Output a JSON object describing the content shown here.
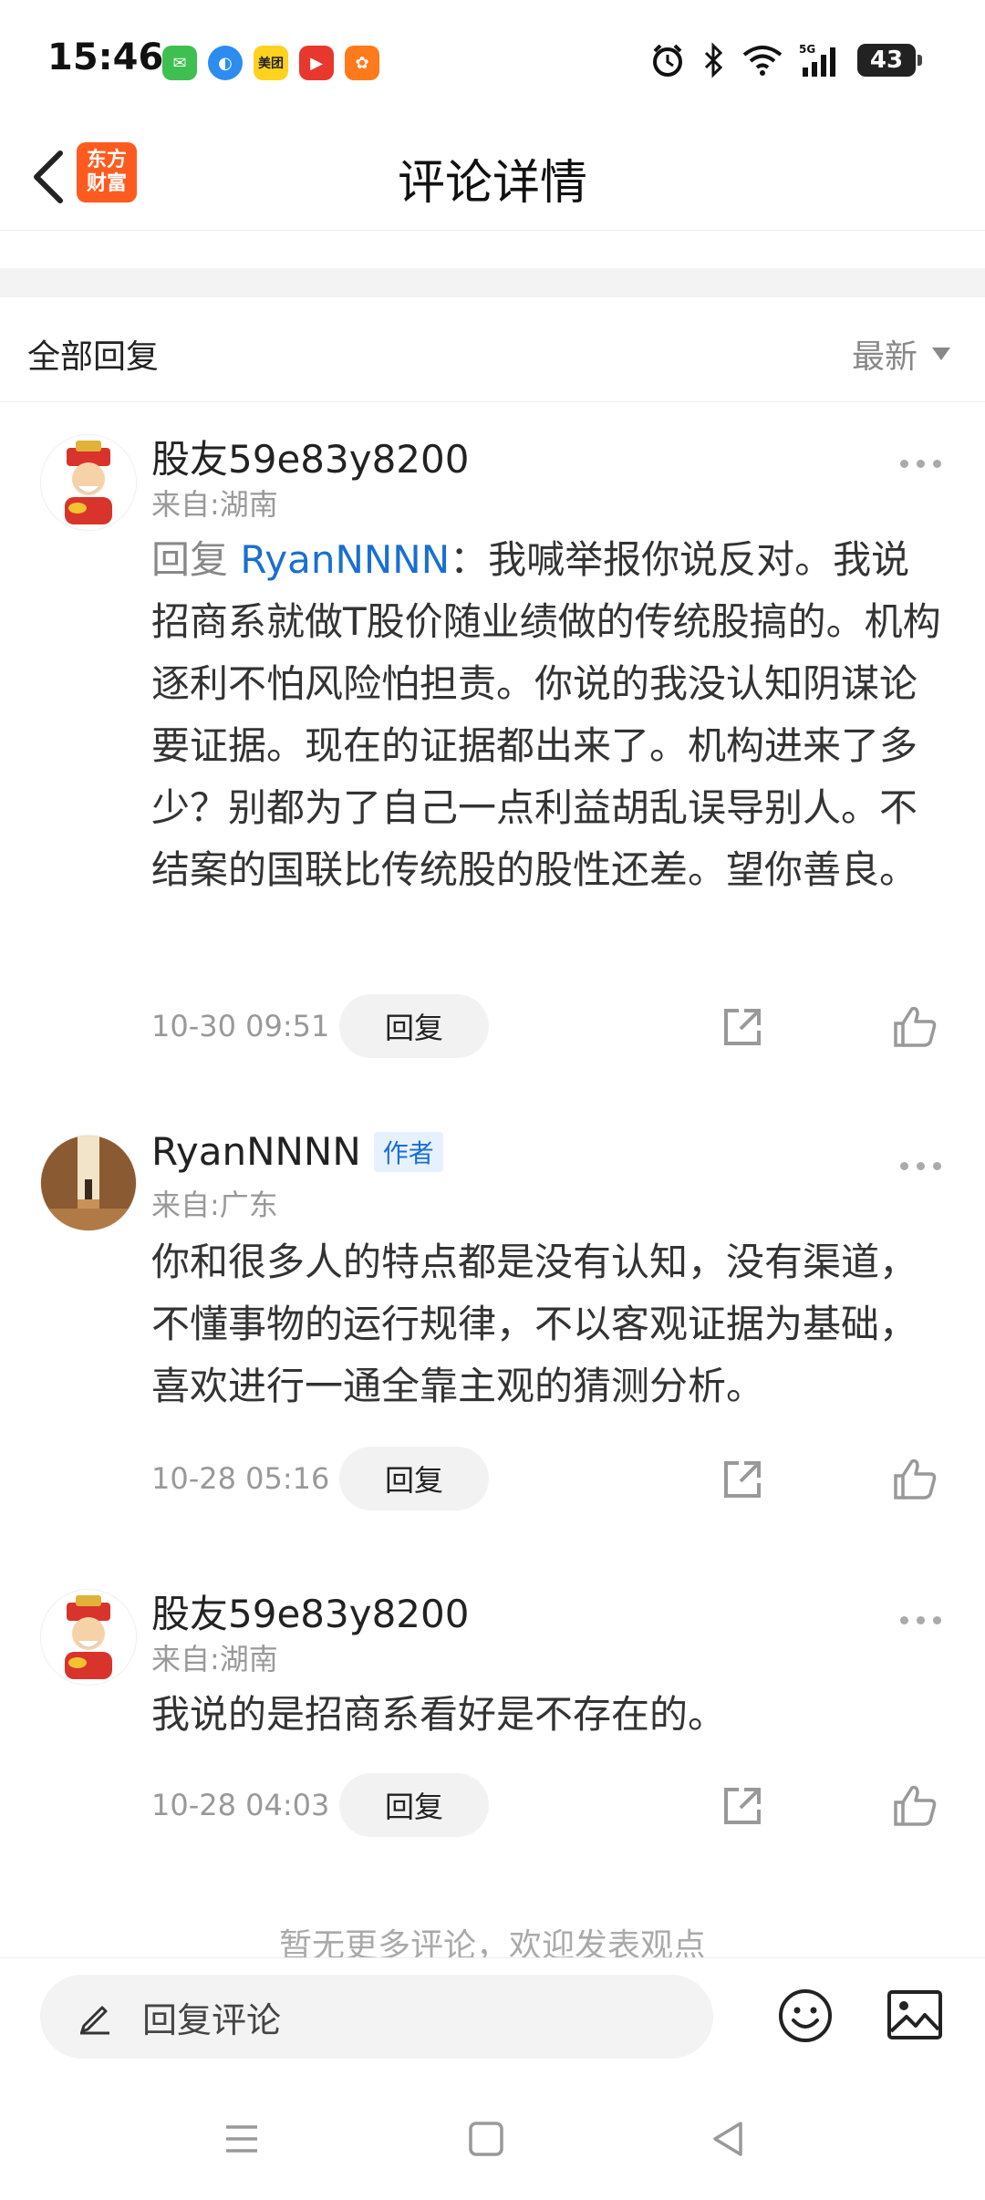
{
  "status_bar": {
    "time": "15:46",
    "battery": "43",
    "apps": [
      "messages-app",
      "browser-app",
      "meituan-app",
      "video-app",
      "taobao-app"
    ],
    "meituan_label": "美团"
  },
  "nav": {
    "title": "评论详情",
    "logo_line1": "东方",
    "logo_line2": "财富"
  },
  "section": {
    "title": "全部回复",
    "sort_label": "最新"
  },
  "comments": [
    {
      "author": "股友59e83y8200",
      "from": "来自:湖南",
      "reply_prefix": "回复 ",
      "reply_target": "RyanNNNN",
      "text": "：我喊举报你说反对。我说招商系就做T股价随业绩做的传统股搞的。机构逐利不怕风险怕担责。你说的我没认知阴谋论要证据。现在的证据都出来了。机构进来了多少？别都为了自己一点利益胡乱误导别人。不结案的国联比传统股的股性还差。望你善良。",
      "time": "10-30 09:51",
      "reply_label": "回复"
    },
    {
      "author": "RyanNNNN",
      "badge": "作者",
      "from": "来自:广东",
      "text": "你和很多人的特点都是没有认知，没有渠道，不懂事物的运行规律，不以客观证据为基础，喜欢进行一通全靠主观的猜测分析。",
      "time": "10-28 05:16",
      "reply_label": "回复"
    },
    {
      "author": "股友59e83y8200",
      "from": "来自:湖南",
      "text": "我说的是招商系看好是不存在的。",
      "time": "10-28 04:03",
      "reply_label": "回复"
    }
  ],
  "footer_note": "暂无更多评论，欢迎发表观点",
  "bottom_bar": {
    "placeholder": "回复评论"
  },
  "colors": {
    "link_blue": "#1a6fd0",
    "logo_orange": "#ff5a1f"
  }
}
